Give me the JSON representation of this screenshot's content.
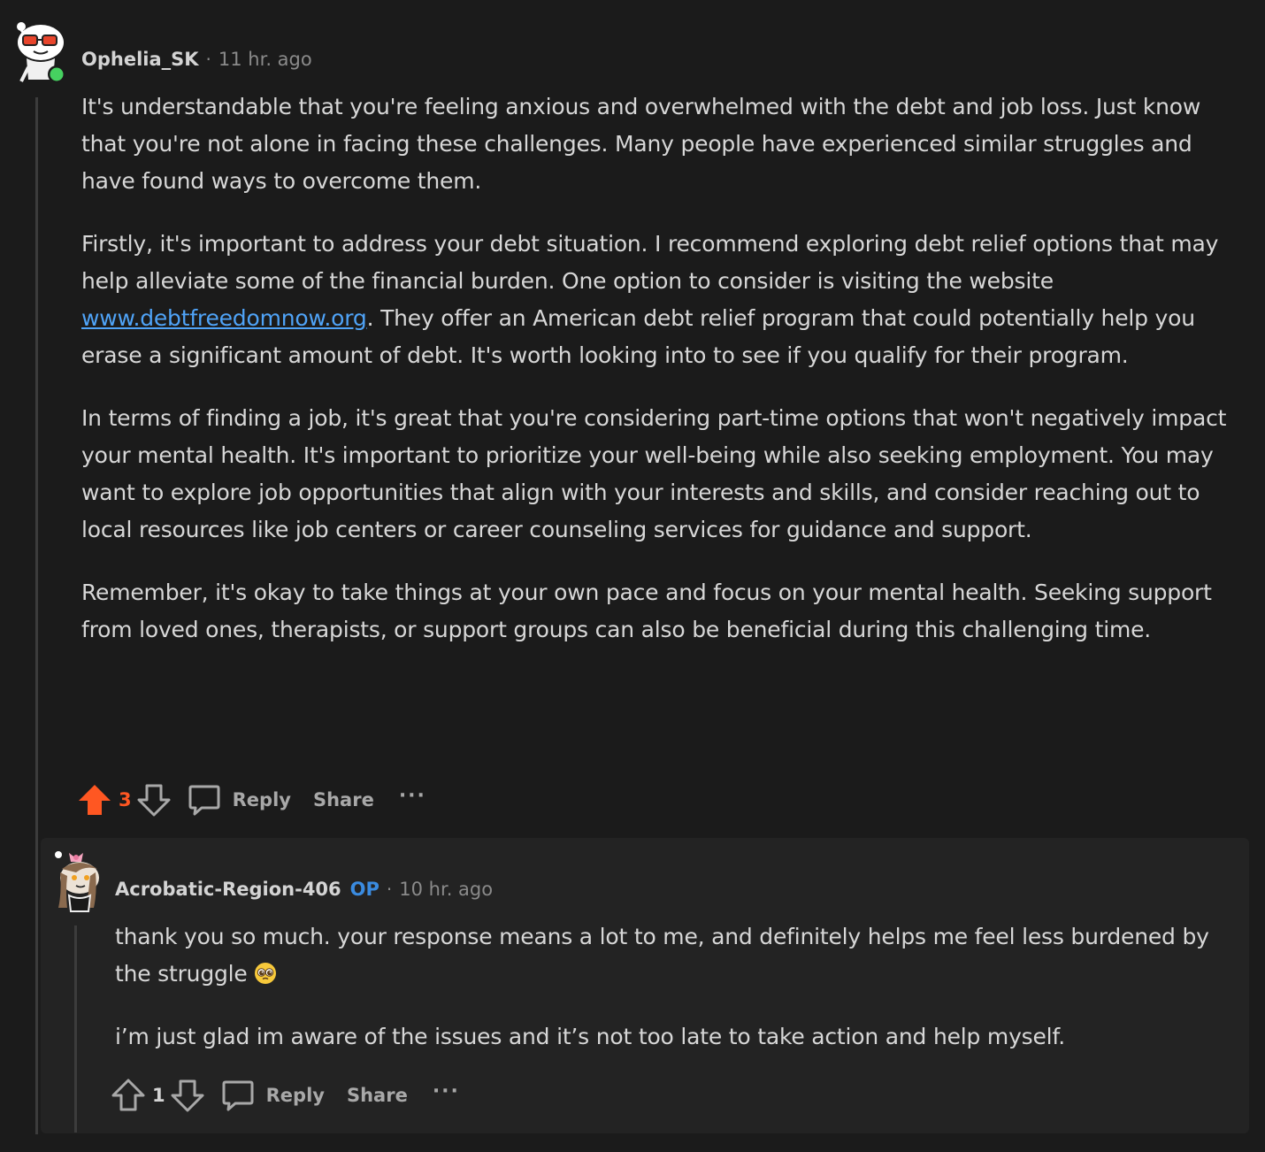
{
  "comment": {
    "username": "Ophelia_SK",
    "separator": "·",
    "time": "11 hr. ago",
    "paragraphs": [
      "It's understandable that you're feeling anxious and overwhelmed with the debt and job loss. Just know that you're not alone in facing these challenges. Many people have experienced similar struggles and have found ways to overcome them.",
      "Remember, it's okay to take things at your own pace and focus on your mental health. Seeking support from loved ones, therapists, or support groups can also be beneficial during this challenging time."
    ],
    "para2_before_link": "Firstly, it's important to address your debt situation. I recommend exploring debt relief options that may help alleviate some of the financial burden. One option to consider is visiting the website ",
    "para2_link": "www.debtfreedomnow.org",
    "para2_after_link": ". They offer an American debt relief program that could potentially help you erase a significant amount of debt. It's worth looking into to see if you qualify for their program.",
    "para3": "In terms of finding a job, it's great that you're considering part-time options that won't negatively impact your mental health. It's important to prioritize your well-being while also seeking employment. You may want to explore job opportunities that align with your interests and skills, and consider reaching out to local resources like job centers or career counseling services for guidance and support.",
    "votes": "3",
    "reply_label": "Reply",
    "share_label": "Share",
    "more_label": "···",
    "colors": {
      "upvoted": "#ff5722",
      "online": "#46d160"
    }
  },
  "reply": {
    "username": "Acrobatic-Region-406",
    "op_badge": "OP",
    "separator": "·",
    "time": "10 hr. ago",
    "para1": "thank you so much. your response means a lot to me, and definitely helps me feel less burdened by the struggle",
    "para1_emoji": "pleading-face-emoji",
    "para2": "i’m just glad im aware of the issues and it’s not too late to take action and help myself.",
    "votes": "1",
    "reply_label": "Reply",
    "share_label": "Share",
    "more_label": "···",
    "colors": {
      "op": "#3a8be0"
    }
  }
}
